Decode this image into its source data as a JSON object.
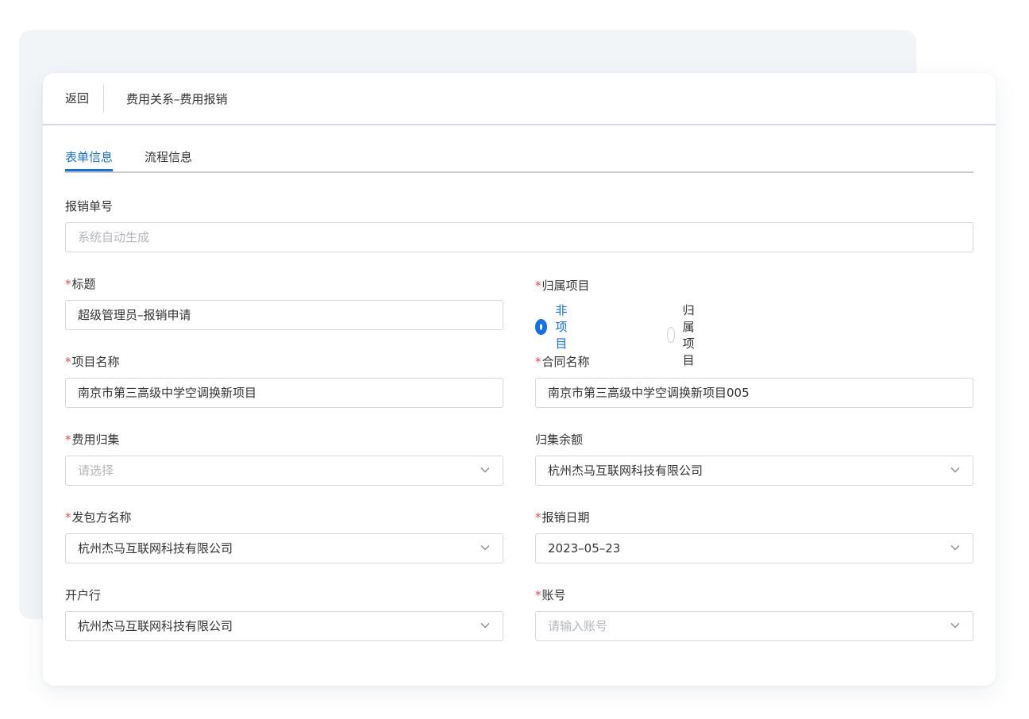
{
  "header": {
    "back_label": "返回",
    "title": "费用关系–费用报销"
  },
  "tabs": [
    {
      "label": "表单信息",
      "active": true
    },
    {
      "label": "流程信息",
      "active": false
    }
  ],
  "form": {
    "expense_no": {
      "label": "报销单号",
      "placeholder": "系统自动生成",
      "value": ""
    },
    "title": {
      "label": "标题",
      "required": true,
      "value": "超级管理员–报销申请"
    },
    "project_belong": {
      "label": "归属项目",
      "required": true,
      "options": [
        {
          "label": "非项目",
          "checked": true
        },
        {
          "label": "归属项目",
          "checked": false
        }
      ]
    },
    "project_name": {
      "label": "项目名称",
      "required": true,
      "value": "南京市第三高级中学空调换新项目"
    },
    "contract_name": {
      "label": "合同名称",
      "required": true,
      "value": "南京市第三高级中学空调换新项目005"
    },
    "cost_collection": {
      "label": "费用归集",
      "required": true,
      "placeholder": "请选择",
      "value": ""
    },
    "collection_balance": {
      "label": "归集余额",
      "required": false,
      "value": "杭州杰马互联网科技有限公司"
    },
    "contractor_name": {
      "label": "发包方名称",
      "required": true,
      "value": "杭州杰马互联网科技有限公司"
    },
    "expense_date": {
      "label": "报销日期",
      "required": true,
      "value": "2023–05–23"
    },
    "bank": {
      "label": "开户行",
      "required": false,
      "value": "杭州杰马互联网科技有限公司"
    },
    "account": {
      "label": "账号",
      "required": true,
      "placeholder": "请输入账号",
      "value": ""
    }
  },
  "colors": {
    "accent": "#1470e6",
    "required": "#e5484d",
    "border": "#d5d8dc",
    "placeholder": "#b3b6bb"
  },
  "icons": {
    "dropdown": "chevron-down-icon",
    "radio": "radio-icon"
  }
}
